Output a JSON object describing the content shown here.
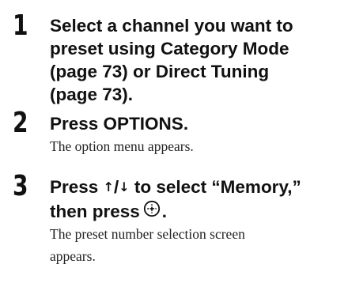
{
  "steps": [
    {
      "number": "1",
      "title_lines": [
        "Select a channel you want to",
        "preset using Category Mode",
        "(page 73) or Direct Tuning",
        "(page 73)."
      ]
    },
    {
      "number": "2",
      "title": "Press OPTIONS.",
      "desc": "The option menu appears."
    },
    {
      "number": "3",
      "title_part1": "Press ",
      "up_arrow": "↑",
      "slash": "/",
      "down_arrow": "↓",
      "title_part2": " to select “Memory,”",
      "title_line2": "then press",
      "enter_icon": "enter-button-icon",
      "title_line2_end": ".",
      "desc_lines": [
        "The preset number selection screen",
        "appears."
      ]
    }
  ]
}
